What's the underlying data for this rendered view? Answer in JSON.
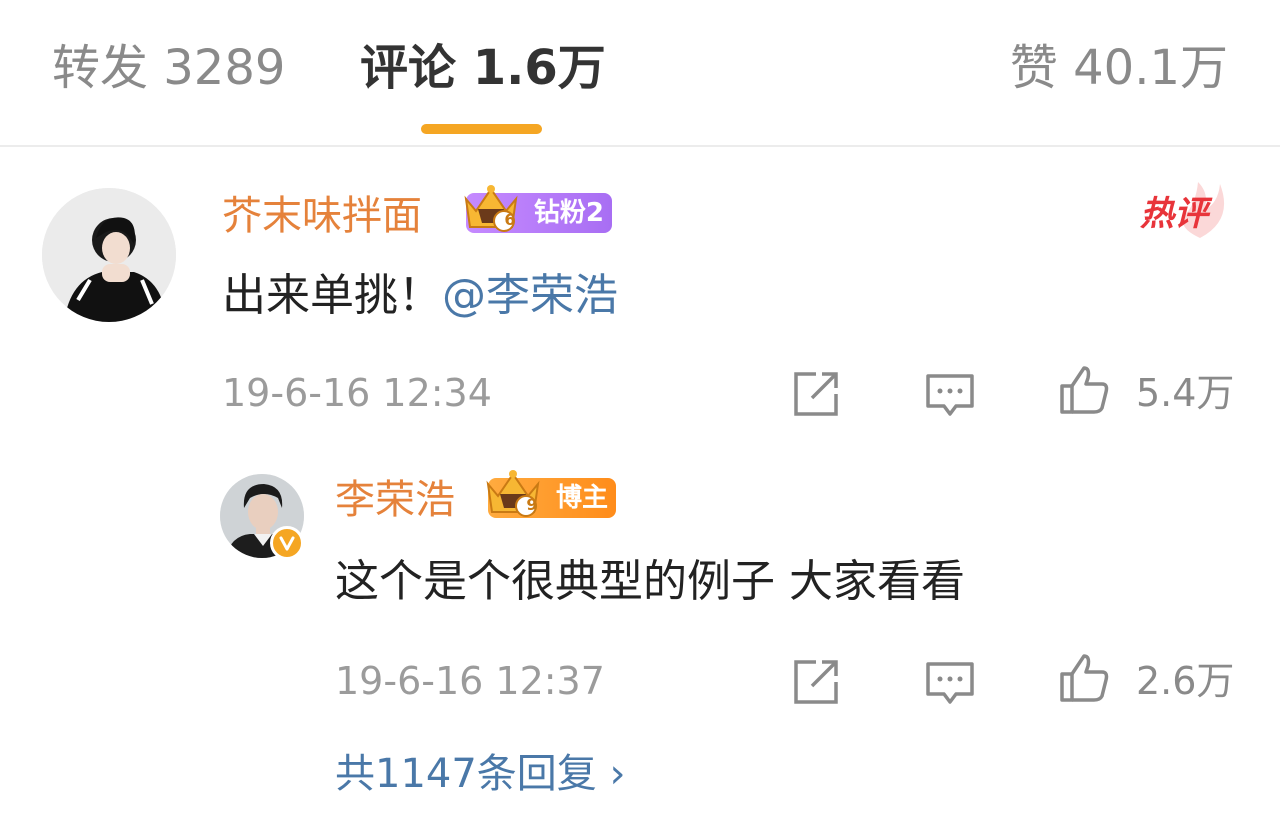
{
  "tabs": {
    "repost": "转发 3289",
    "comments": "评论 1.6万",
    "likes": "赞 40.1万",
    "active_color": "#f5a623"
  },
  "comment": {
    "username": "芥末味拌面",
    "fan_badge": {
      "level": "6",
      "label": "钻粉2"
    },
    "hot_tag": "热评",
    "text_before_mention": "出来单挑！",
    "mention": "@李荣浩",
    "timestamp": "19-6-16 12:34",
    "like_count": "5.4万",
    "icons": [
      "share-icon",
      "reply-icon",
      "thumbs-up-icon"
    ]
  },
  "reply": {
    "username": "李荣浩",
    "fan_badge": {
      "level": "9",
      "label": "博主"
    },
    "verified": true,
    "text": "这个是个很典型的例子 大家看看",
    "timestamp": "19-6-16 12:37",
    "like_count": "2.6万",
    "icons": [
      "share-icon",
      "reply-icon",
      "thumbs-up-icon"
    ]
  },
  "more_replies": "共1147条回复 ›",
  "colors": {
    "username": "#e5823b",
    "link": "#4a78a8",
    "hot": "#e8343a",
    "muted": "#9b9b9b"
  }
}
